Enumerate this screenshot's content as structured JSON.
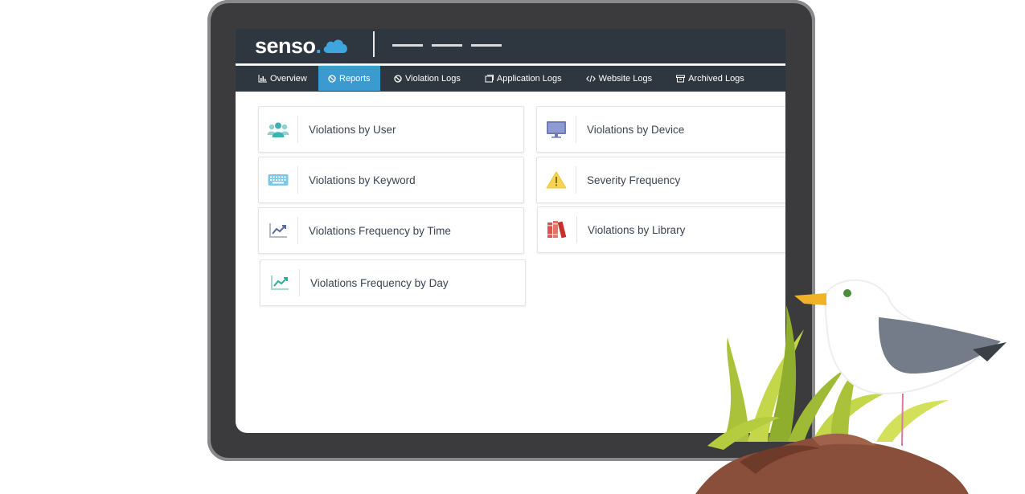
{
  "app": {
    "logo_text": "senso",
    "logo_dot": ".",
    "nav_tabs": [
      {
        "label": "Overview",
        "icon": "bar-chart-icon",
        "active": false
      },
      {
        "label": "Reports",
        "icon": "ban-icon",
        "active": true
      },
      {
        "label": "Violation Logs",
        "icon": "ban-icon",
        "active": false
      },
      {
        "label": "Application Logs",
        "icon": "window-icon",
        "active": false
      },
      {
        "label": "Website Logs",
        "icon": "code-icon",
        "active": false
      },
      {
        "label": "Archived Logs",
        "icon": "archive-icon",
        "active": false
      }
    ]
  },
  "reports": [
    {
      "label": "Violations by User",
      "icon": "users-icon"
    },
    {
      "label": "Violations by Keyword",
      "icon": "keyboard-icon"
    },
    {
      "label": "Violations Frequency by Time",
      "icon": "trend-chart-icon"
    },
    {
      "label": "Violations Frequency by Day",
      "icon": "trend-chart-icon"
    },
    {
      "label": "Violations by Device",
      "icon": "monitor-icon"
    },
    {
      "label": "Severity Frequency",
      "icon": "warning-icon"
    },
    {
      "label": "Violations by Library",
      "icon": "books-icon"
    }
  ],
  "colors": {
    "header_bg": "#2e3740",
    "active_tab": "#3b9bd0",
    "cloud": "#3ea6dd",
    "tablet_frame": "#3b3b3d"
  }
}
